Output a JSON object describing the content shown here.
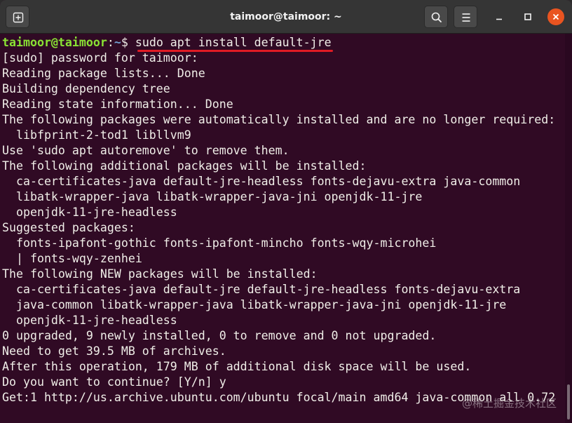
{
  "window": {
    "title": "taimoor@taimoor: ~"
  },
  "colors": {
    "terminal_bg": "#300a24",
    "prompt_user": "#8ae234",
    "prompt_path": "#729fcf",
    "close_button": "#e95420",
    "highlight_underline": "#e01b24"
  },
  "icons": {
    "new_tab": "new-tab-icon",
    "search": "search-icon",
    "menu": "hamburger-menu-icon",
    "minimize": "minimize-icon",
    "maximize": "maximize-icon",
    "close": "close-icon"
  },
  "prompt": {
    "user_host": "taimoor@taimoor",
    "sep": ":",
    "path": "~",
    "dollar": "$ ",
    "command": "sudo apt install default-jre"
  },
  "output": [
    "[sudo] password for taimoor:",
    "Reading package lists... Done",
    "Building dependency tree",
    "Reading state information... Done",
    "The following packages were automatically installed and are no longer required:",
    "  libfprint-2-tod1 libllvm9",
    "Use 'sudo apt autoremove' to remove them.",
    "The following additional packages will be installed:",
    "  ca-certificates-java default-jre-headless fonts-dejavu-extra java-common",
    "  libatk-wrapper-java libatk-wrapper-java-jni openjdk-11-jre",
    "  openjdk-11-jre-headless",
    "Suggested packages:",
    "  fonts-ipafont-gothic fonts-ipafont-mincho fonts-wqy-microhei",
    "  | fonts-wqy-zenhei",
    "The following NEW packages will be installed:",
    "  ca-certificates-java default-jre default-jre-headless fonts-dejavu-extra",
    "  java-common libatk-wrapper-java libatk-wrapper-java-jni openjdk-11-jre",
    "  openjdk-11-jre-headless",
    "0 upgraded, 9 newly installed, 0 to remove and 0 not upgraded.",
    "Need to get 39.5 MB of archives.",
    "After this operation, 179 MB of additional disk space will be used.",
    "Do you want to continue? [Y/n] y",
    "Get:1 http://us.archive.ubuntu.com/ubuntu focal/main amd64 java-common all 0.72"
  ],
  "watermark": "@稀土掘金技术社区"
}
